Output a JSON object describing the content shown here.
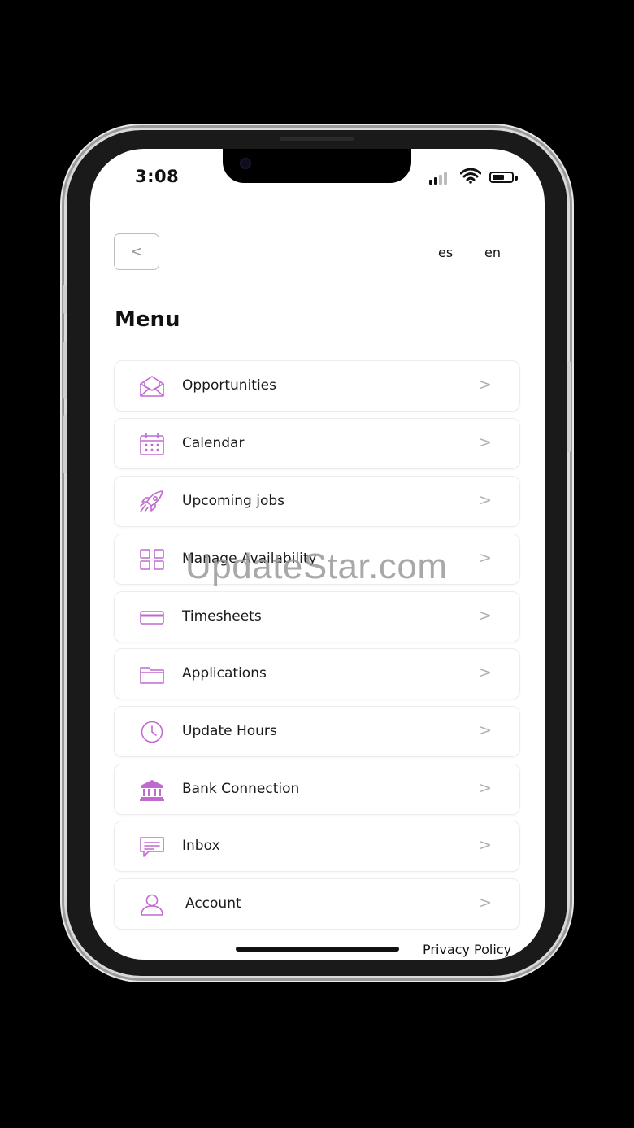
{
  "status_bar": {
    "time": "3:08"
  },
  "header": {
    "back_label": "<",
    "languages": [
      "es",
      "en"
    ]
  },
  "menu": {
    "title": "Menu",
    "chevron": ">",
    "items": [
      {
        "label": "Opportunities",
        "icon": "envelope-open-icon"
      },
      {
        "label": "Calendar",
        "icon": "calendar-icon"
      },
      {
        "label": "Upcoming jobs",
        "icon": "rocket-icon"
      },
      {
        "label": "Manage Availability",
        "icon": "grid-icon"
      },
      {
        "label": "Timesheets",
        "icon": "credit-card-icon"
      },
      {
        "label": "Applications",
        "icon": "folder-icon"
      },
      {
        "label": "Update Hours",
        "icon": "clock-icon"
      },
      {
        "label": "Bank Connection",
        "icon": "bank-icon"
      },
      {
        "label": "Inbox",
        "icon": "chat-icon"
      },
      {
        "label": "Account",
        "icon": "user-icon"
      }
    ]
  },
  "footer": {
    "privacy_label": "Privacy Policy"
  },
  "watermark": "UpdateStar.com",
  "colors": {
    "accent": "#c06ad0",
    "background": "#ffffff",
    "text": "#1a1a1a"
  }
}
